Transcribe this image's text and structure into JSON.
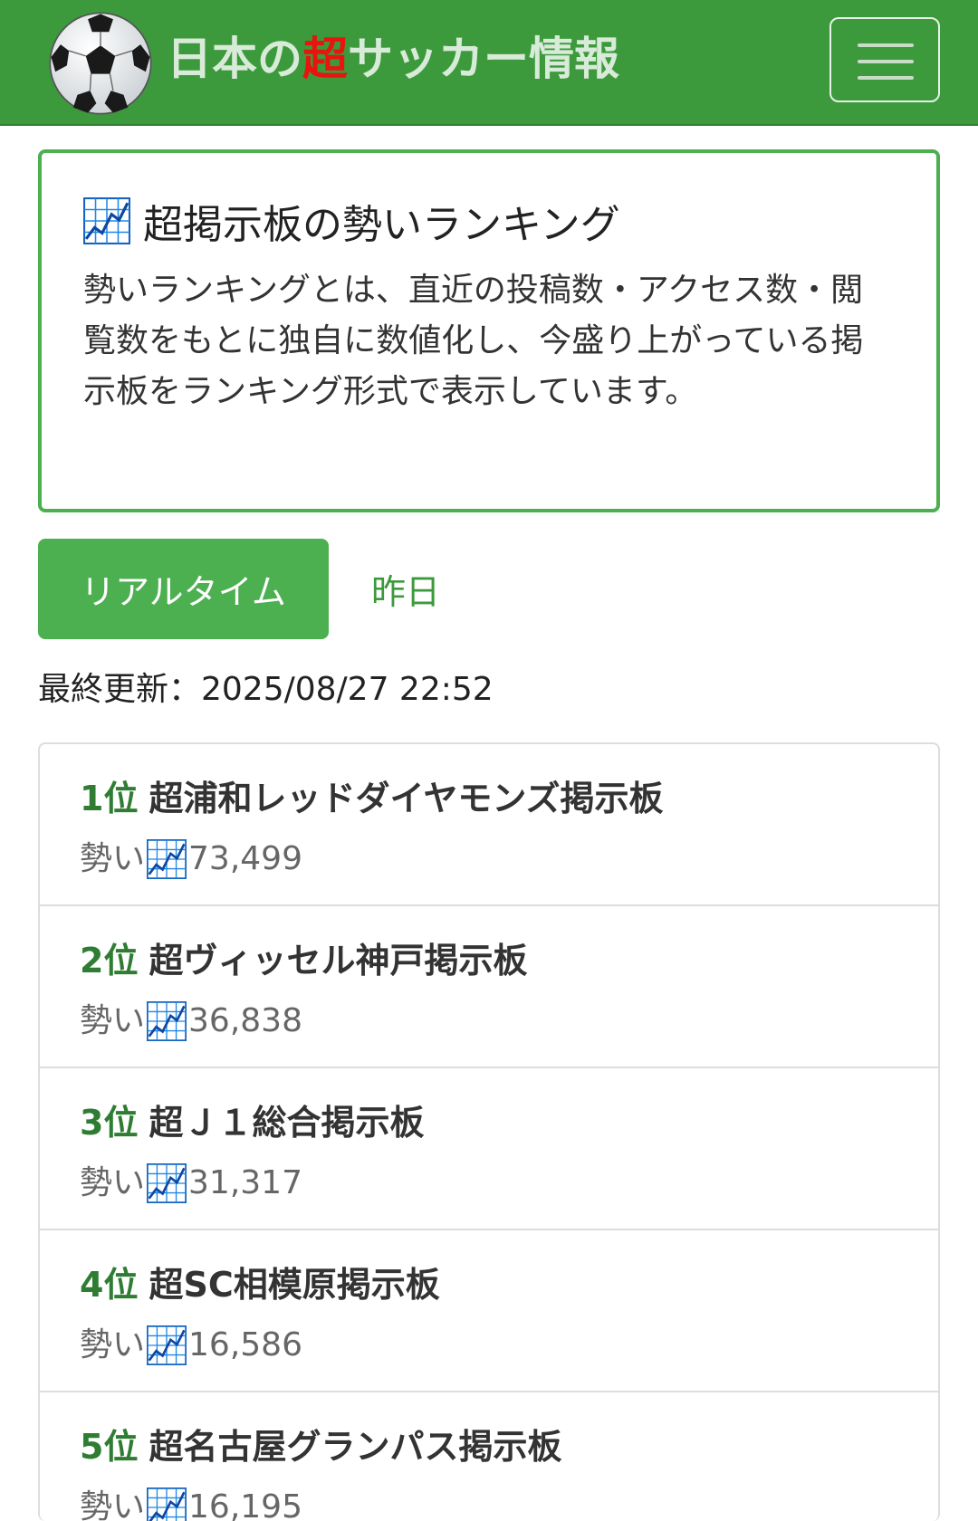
{
  "header": {
    "brand_pre": "日本の",
    "brand_accent": "超",
    "brand_post": "サッカー情報",
    "logo_icon": "soccer-ball-icon",
    "menu_icon": "hamburger-menu-icon"
  },
  "info": {
    "title": "超掲示板の勢いランキング",
    "title_icon": "chart-increasing-icon",
    "description": "勢いランキングとは、直近の投稿数・アクセス数・閲覧数をもとに独自に数値化し、今盛り上がっている掲示板をランキング形式で表示しています。"
  },
  "tabs": {
    "realtime": "リアルタイム",
    "yesterday": "昨日"
  },
  "last_updated": "最終更新：2025/08/27 22:52",
  "rankings": [
    {
      "rank": "1位",
      "name": "超浦和レッドダイヤモンズ掲示板",
      "stat_label": "勢い",
      "value": "73,499"
    },
    {
      "rank": "2位",
      "name": "超ヴィッセル神戸掲示板",
      "stat_label": "勢い",
      "value": "36,838"
    },
    {
      "rank": "3位",
      "name": "超Ｊ１総合掲示板",
      "stat_label": "勢い",
      "value": "31,317"
    },
    {
      "rank": "4位",
      "name": "超SC相模原掲示板",
      "stat_label": "勢い",
      "value": "16,586"
    },
    {
      "rank": "5位",
      "name": "超名古屋グランパス掲示板",
      "stat_label": "勢い",
      "value": "16,195"
    }
  ],
  "colors": {
    "header_bg": "#3c9a3c",
    "accent_green": "#4caf50",
    "rank_green": "#2e7d32",
    "brand_accent": "#e8140e"
  }
}
